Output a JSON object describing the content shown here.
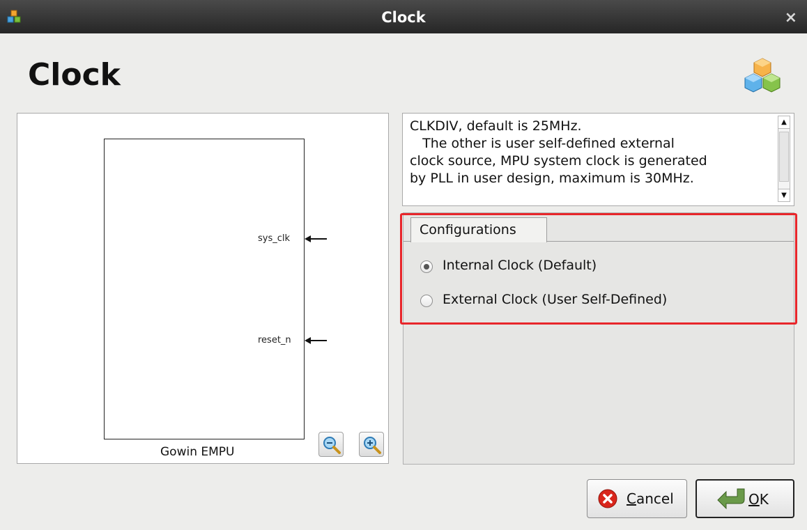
{
  "window": {
    "title": "Clock",
    "close_glyph": "×",
    "app_icon": "blocks-icon"
  },
  "header": {
    "title": "Clock",
    "logo_icon": "blocks-logo-icon"
  },
  "preview": {
    "block_name": "Gowin EMPU",
    "ports": [
      {
        "label": "sys_clk"
      },
      {
        "label": "reset_n"
      }
    ],
    "zoom_out_icon": "zoom-out-icon",
    "zoom_in_icon": "zoom-in-icon"
  },
  "description": {
    "lines": [
      "CLKDIV, default is 25MHz.",
      "   The other is user self-defined external",
      "clock source, MPU system clock is generated",
      "by PLL in user design, maximum is 30MHz."
    ]
  },
  "configurations": {
    "tab_label": "Configurations",
    "options": [
      {
        "label": "Internal Clock (Default)",
        "selected": true
      },
      {
        "label": "External Clock (User Self-Defined)",
        "selected": false
      }
    ]
  },
  "buttons": {
    "cancel": {
      "prefix": "",
      "mnemonic": "C",
      "rest": "ancel"
    },
    "ok": {
      "mnemonic": "O",
      "rest": "K"
    }
  },
  "colors": {
    "highlight": "#e8262b",
    "cancel_icon": "#d9261c",
    "ok_icon": "#6a9a4a"
  }
}
